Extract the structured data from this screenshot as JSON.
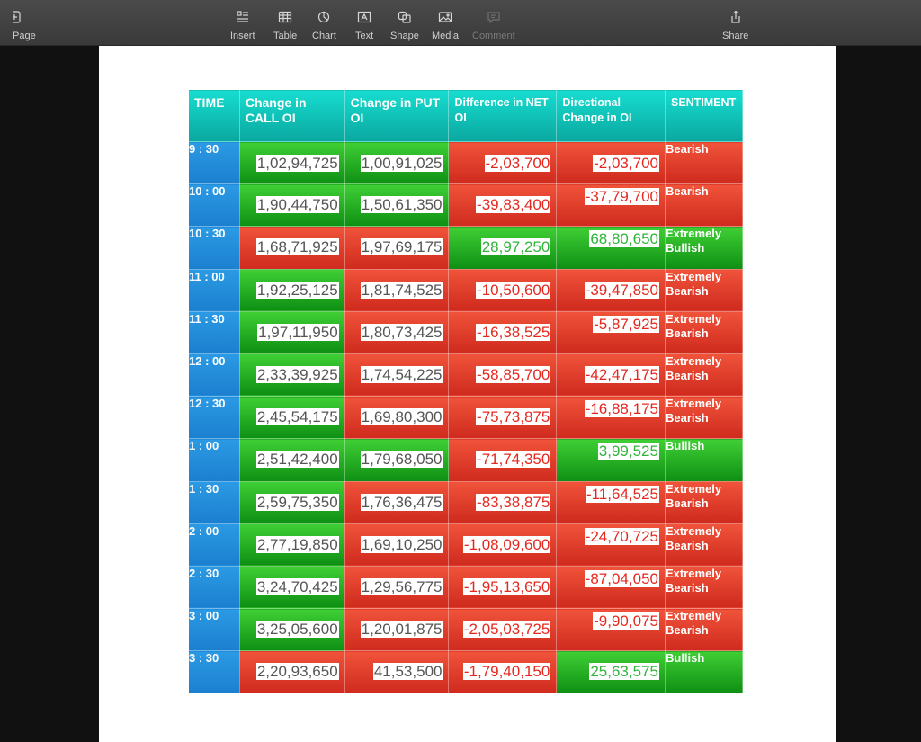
{
  "toolbar": {
    "page_label": "Page",
    "insert_label": "Insert",
    "table_label": "Table",
    "chart_label": "Chart",
    "text_label": "Text",
    "shape_label": "Shape",
    "media_label": "Media",
    "comment_label": "Comment",
    "share_label": "Share"
  },
  "colors": {
    "header": "#12c9be",
    "time": "#2491dc",
    "green": "#28b524",
    "red": "#e23f2b",
    "text_red": "#e5281f",
    "text_green": "#2fb43a"
  },
  "table": {
    "headers": [
      "TIME",
      "Change in CALL OI",
      "Change in PUT OI",
      "Difference in NET OI",
      "Directional Change in OI",
      "SENTIMENT"
    ],
    "rows": [
      {
        "time": "9 : 30",
        "call": "1,02,94,725",
        "put": "1,00,91,025",
        "diff": "-2,03,700",
        "dir": "-2,03,700",
        "sentiment": "Bearish"
      },
      {
        "time": "10 : 00",
        "call": "1,90,44,750",
        "put": "1,50,61,350",
        "diff": "-39,83,400",
        "dir": "-37,79,700",
        "sentiment": "Bearish"
      },
      {
        "time": "10 : 30",
        "call": "1,68,71,925",
        "put": "1,97,69,175",
        "diff": "28,97,250",
        "dir": "68,80,650",
        "sentiment": "Extremely Bullish"
      },
      {
        "time": "11 : 00",
        "call": "1,92,25,125",
        "put": "1,81,74,525",
        "diff": "-10,50,600",
        "dir": "-39,47,850",
        "sentiment": "Extremely Bearish"
      },
      {
        "time": "11 : 30",
        "call": "1,97,11,950",
        "put": "1,80,73,425",
        "diff": "-16,38,525",
        "dir": "-5,87,925",
        "sentiment": "Extremely Bearish"
      },
      {
        "time": "12 : 00",
        "call": "2,33,39,925",
        "put": "1,74,54,225",
        "diff": "-58,85,700",
        "dir": "-42,47,175",
        "sentiment": "Extremely Bearish"
      },
      {
        "time": "12 : 30",
        "call": "2,45,54,175",
        "put": "1,69,80,300",
        "diff": "-75,73,875",
        "dir": "-16,88,175",
        "sentiment": "Extremely Bearish"
      },
      {
        "time": "1 : 00",
        "call": "2,51,42,400",
        "put": "1,79,68,050",
        "diff": "-71,74,350",
        "dir": "3,99,525",
        "sentiment": "Bullish"
      },
      {
        "time": "1 : 30",
        "call": "2,59,75,350",
        "put": "1,76,36,475",
        "diff": "-83,38,875",
        "dir": "-11,64,525",
        "sentiment": "Extremely Bearish"
      },
      {
        "time": "2 : 00",
        "call": "2,77,19,850",
        "put": "1,69,10,250",
        "diff": "-1,08,09,600",
        "dir": "-24,70,725",
        "sentiment": "Extremely Bearish"
      },
      {
        "time": "2 : 30",
        "call": "3,24,70,425",
        "put": "1,29,56,775",
        "diff": "-1,95,13,650",
        "dir": "-87,04,050",
        "sentiment": "Extremely Bearish"
      },
      {
        "time": "3 : 00",
        "call": "3,25,05,600",
        "put": "1,20,01,875",
        "diff": "-2,05,03,725",
        "dir": "-9,90,075",
        "sentiment": "Extremely Bearish"
      },
      {
        "time": "3 : 30",
        "call": "2,20,93,650",
        "put": "41,53,500",
        "diff": "-1,79,40,150",
        "dir": "25,63,575",
        "sentiment": "Bullish"
      }
    ]
  }
}
